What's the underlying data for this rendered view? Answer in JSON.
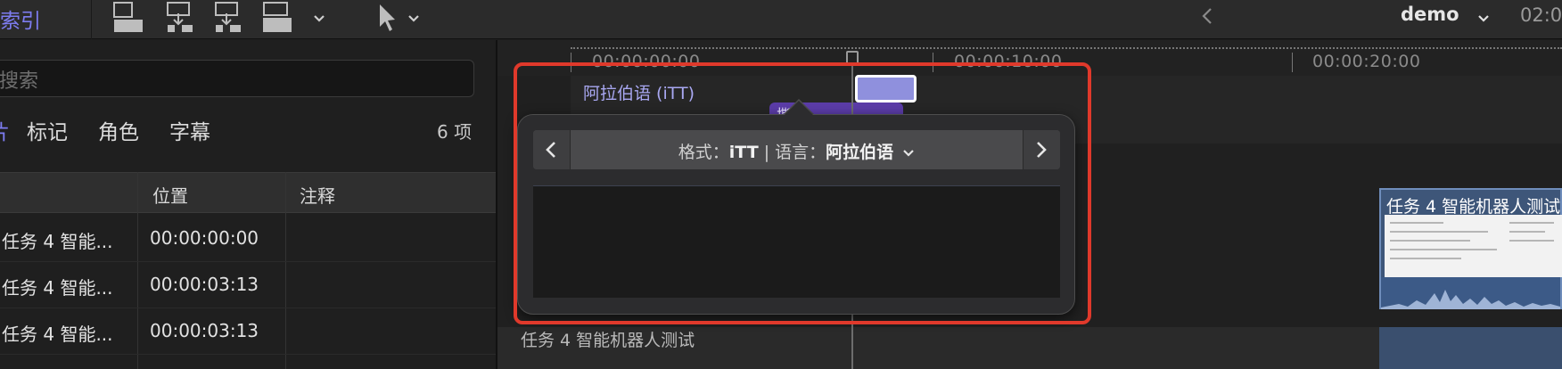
{
  "toolbar": {
    "index_title": "索引",
    "icons": [
      "connect-clip-icon",
      "insert-clip-icon",
      "append-clip-icon",
      "overwrite-clip-icon",
      "chevron-down-icon",
      "select-tool-icon",
      "chevron-down-icon",
      "back-chevron-icon"
    ],
    "project_name": "demo",
    "timecode": "02:0"
  },
  "index": {
    "search_placeholder": "搜索",
    "tabs": [
      {
        "label": "片段",
        "visible": "片"
      },
      {
        "label": "标记"
      },
      {
        "label": "角色"
      },
      {
        "label": "字幕"
      }
    ],
    "count": "6 项",
    "columns": [
      "",
      "位置",
      "注释"
    ],
    "rows": [
      {
        "name": "任务 4 智能...",
        "position": "00:00:00:00",
        "note": ""
      },
      {
        "name": "任务 4 智能...",
        "position": "00:00:03:13",
        "note": ""
      },
      {
        "name": "任务 4 智能...",
        "position": "00:00:03:13",
        "note": ""
      }
    ]
  },
  "timeline": {
    "ruler_labels": [
      "00:00:00:00",
      "00:00:10:00",
      "00:00:20:00"
    ],
    "caption_track_label": "阿拉伯语 (iTT)",
    "purple_tag": "撕边",
    "video_clip_title": "任务 4 智能机器人测试",
    "bottom_clip_title": "任务 4 智能机器人测试"
  },
  "caption_popover": {
    "format_label": "格式：",
    "format_value": "iTT",
    "separator": " | ",
    "language_label": "语言：",
    "language_value": "阿拉伯语",
    "editor_text": ""
  },
  "colors": {
    "accent": "#7d7cf0",
    "caption_clip": "#8f90dd",
    "highlight_box": "#e0392b",
    "video_clip": "#3e5679"
  }
}
